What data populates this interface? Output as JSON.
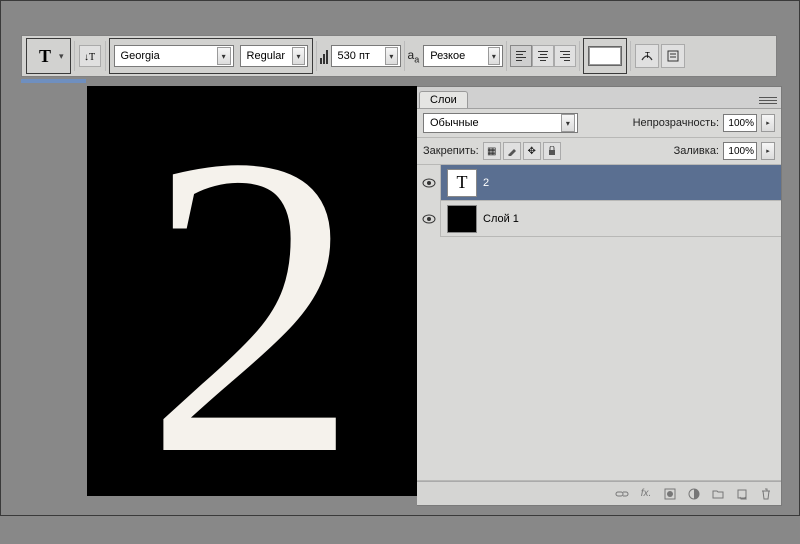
{
  "toolbar": {
    "font_family": "Georgia",
    "font_style": "Regular",
    "font_size": "530 пт",
    "anti_alias": "Резкое",
    "text_color": "#ffffff"
  },
  "canvas": {
    "content": "2"
  },
  "panel": {
    "tab": "Слои",
    "blend_mode": "Обычные",
    "opacity_label": "Непрозрачность:",
    "opacity_value": "100%",
    "lock_label": "Закрепить:",
    "fill_label": "Заливка:",
    "fill_value": "100%",
    "layers": [
      {
        "name": "2",
        "type": "text",
        "visible": true,
        "selected": true
      },
      {
        "name": "Слой 1",
        "type": "raster",
        "visible": true,
        "selected": false
      }
    ],
    "fx_label": "fx."
  }
}
